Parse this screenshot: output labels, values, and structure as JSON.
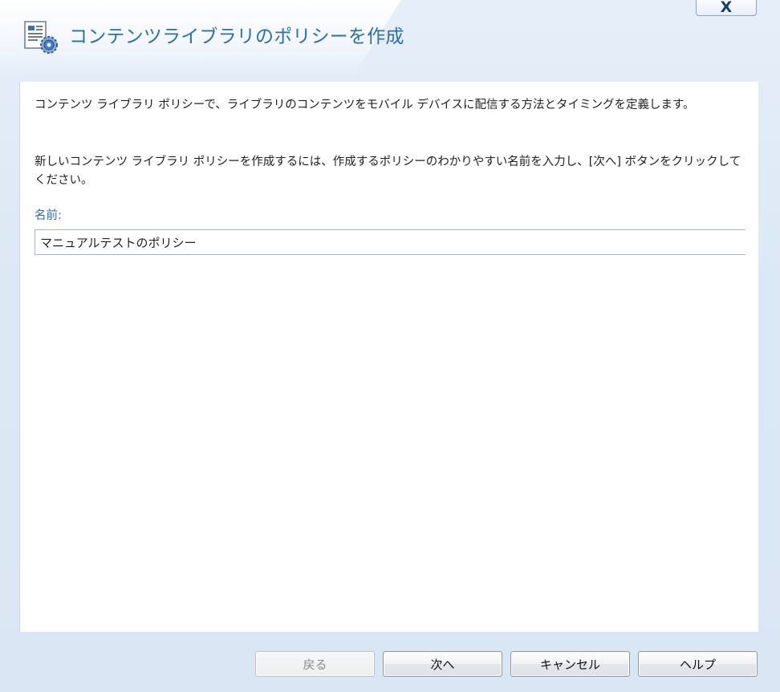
{
  "window": {
    "title": "コンテンツライブラリのポリシーを作成",
    "close_label": "X"
  },
  "header": {
    "icon": "policy-document-gear-icon"
  },
  "content": {
    "description_1": "コンテンツ ライブラリ ポリシーで、ライブラリのコンテンツをモバイル デバイスに配信する方法とタイミングを定義します。",
    "description_2": "新しいコンテンツ ライブラリ ポリシーを作成するには、作成するポリシーのわかりやすい名前を入力し、[次へ] ボタンをクリックしてください。",
    "name_label": "名前:",
    "name_value": "マニュアルテストのポリシー"
  },
  "footer": {
    "back_label": "戻る",
    "next_label": "次へ",
    "cancel_label": "キャンセル",
    "help_label": "ヘルプ"
  },
  "colors": {
    "accent": "#2a6fb5",
    "background": "#dfe9f6",
    "panel": "#ffffff"
  }
}
